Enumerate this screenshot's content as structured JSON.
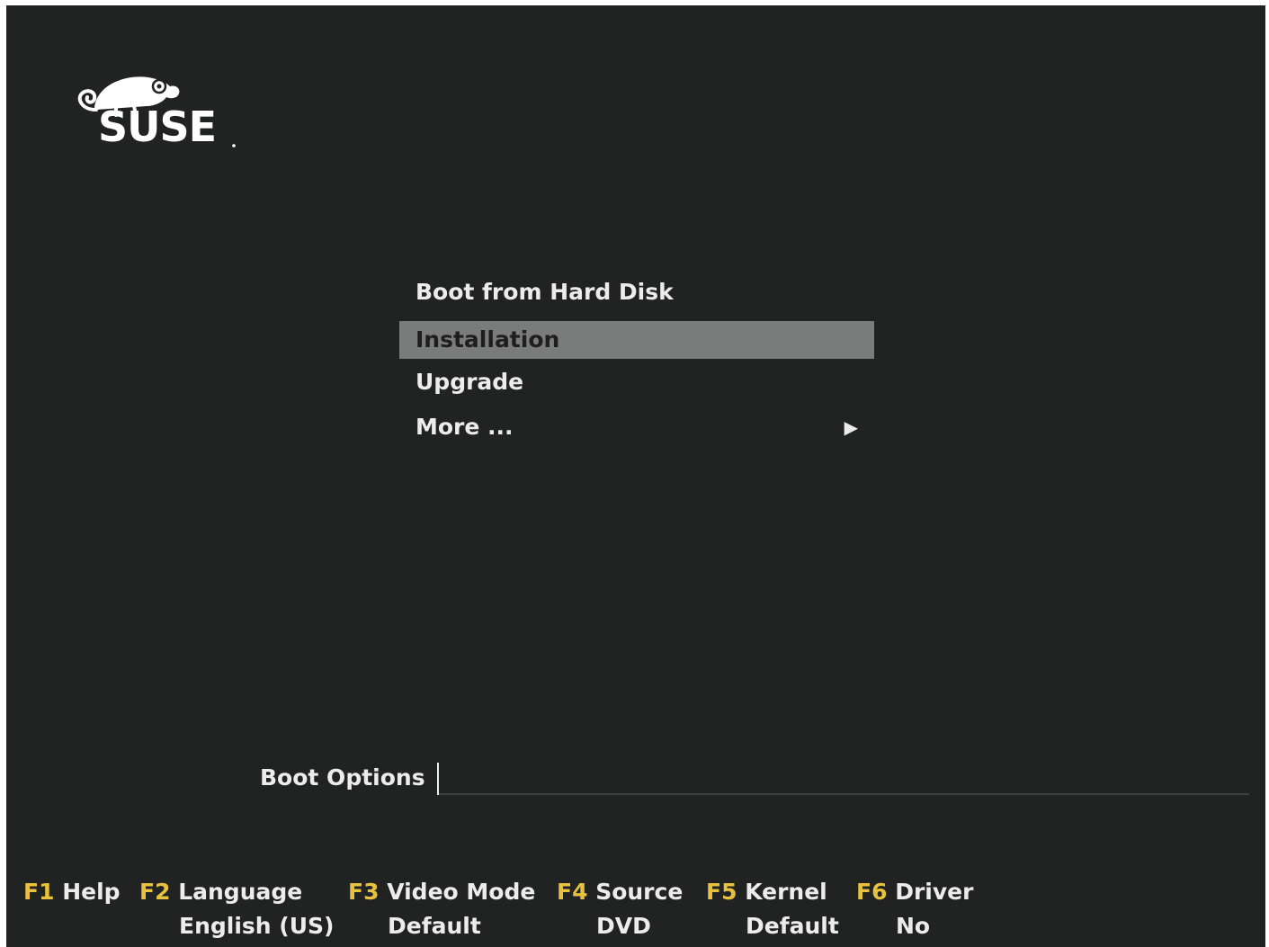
{
  "brand": {
    "name": "SUSE"
  },
  "menu": {
    "items": [
      {
        "label": "Boot from Hard Disk"
      },
      {
        "label": "Installation"
      },
      {
        "label": "Upgrade"
      },
      {
        "label": "More ..."
      }
    ],
    "selected_index": 1
  },
  "boot_options": {
    "label": "Boot Options",
    "value": ""
  },
  "function_keys": [
    {
      "key": "F1",
      "label": "Help",
      "value": ""
    },
    {
      "key": "F2",
      "label": "Language",
      "value": "English (US)"
    },
    {
      "key": "F3",
      "label": "Video Mode",
      "value": "Default"
    },
    {
      "key": "F4",
      "label": "Source",
      "value": "DVD"
    },
    {
      "key": "F5",
      "label": "Kernel",
      "value": "Default"
    },
    {
      "key": "F6",
      "label": "Driver",
      "value": "No"
    }
  ],
  "colors": {
    "background": "#202322",
    "highlight": "#7a7c7b",
    "fkey_accent": "#e8c23e",
    "text": "#ececec"
  },
  "icons": {
    "logo": "suse-chameleon-logo",
    "submenu": "triangle-right-icon"
  }
}
